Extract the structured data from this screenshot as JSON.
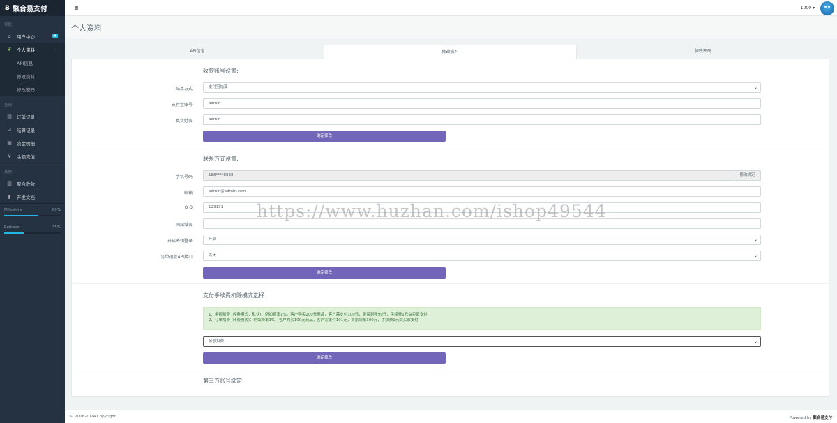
{
  "brand": {
    "logo": "Ƀ",
    "name": "聚合易支付"
  },
  "sidebar": {
    "sections": [
      {
        "head": "导航"
      },
      {
        "head": "查询"
      },
      {
        "head": "其他"
      }
    ],
    "nav_user_center": "用户中心",
    "nav_user_center_badge": "●",
    "nav_profile": "个人资料",
    "nav_profile_chevron": "⌄",
    "sub_items": [
      "API信息",
      "修改资料",
      "修改密码"
    ],
    "query_items": [
      "订单记录",
      "结算记录",
      "资金明细",
      "余额充值"
    ],
    "other_items": [
      "聚合收款",
      "开发文档"
    ],
    "progress": [
      {
        "label": "Milestone",
        "value": "60%",
        "fraction": 0.6
      },
      {
        "label": "Release",
        "value": "35%",
        "fraction": 0.35
      }
    ]
  },
  "header": {
    "menu_icon": "≣",
    "user": "1000 ▾"
  },
  "page": {
    "title": "个人资料"
  },
  "tabs": [
    "API信息",
    "修改资料",
    "修改密码"
  ],
  "settle": {
    "title": "收款账号设置:",
    "method_label": "结算方式",
    "method_value": "支付宝结算",
    "account_label": "支付宝账号",
    "account_value": "admin",
    "name_label": "真实姓名",
    "name_value": "admin",
    "submit": "确定修改"
  },
  "contact": {
    "title": "联系方式设置:",
    "phone_label": "手机号码",
    "phone_value": "188****8888",
    "phone_addon": "修改绑定",
    "email_label": "邮箱",
    "email_value": "admin@admin.com",
    "qq_label": "Q Q",
    "qq_value": "123131",
    "domain_label": "网站域名",
    "domain_value": "",
    "key_login_label": "开启密钥登录",
    "key_login_value": "开启",
    "refund_label": "订单退款API接口",
    "refund_value": "关闭",
    "submit": "确定修改"
  },
  "fee": {
    "title": "支付手续费扣除模式选择:",
    "note_1": "1、余额扣费 (经典模式，默认)：例如费率1%，客户购买100元商品，客户需支付100元，卖家到账99元，手续费1元由卖家支付",
    "note_2": "2、订单加费 (环费模式)：例如费率1%，客户购买100元商品，客户需支付101元，卖家到账100元，手续费1元由买家支付",
    "mode_value": "余额扣费",
    "submit": "确定修改"
  },
  "third_party": {
    "title": "第三方账号绑定:"
  },
  "footer": {
    "copyright": "© 2016-2024 Copyright.",
    "powered_prefix": "Powered by",
    "powered_name": "聚合易支付"
  },
  "watermark": "https://www.huzhan.com/ishop49544"
}
